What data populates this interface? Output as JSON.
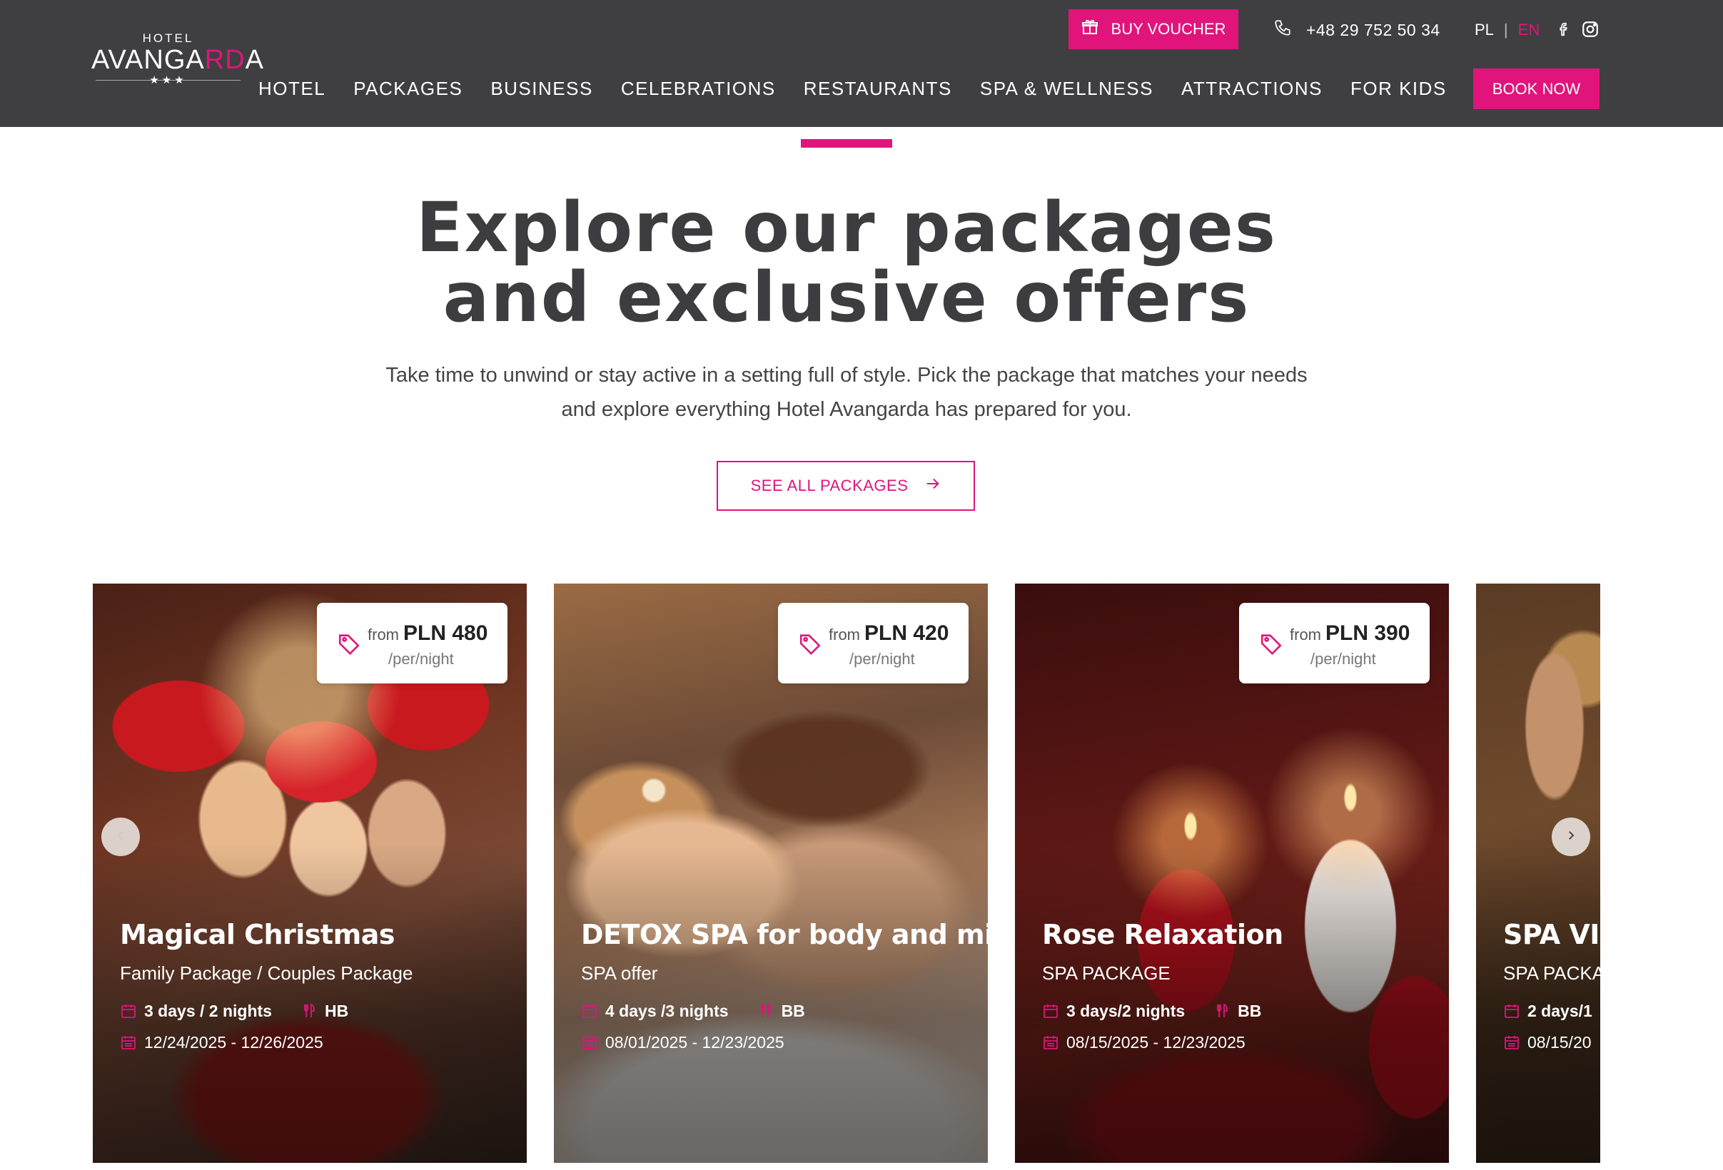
{
  "logo": {
    "small": "HOTEL",
    "big_pre": "AVANGA",
    "big_accent": "RD",
    "big_post": "A",
    "stars": "★★★"
  },
  "header": {
    "voucher_label": "BUY VOUCHER",
    "phone": "+48 29 752 50 34",
    "lang_pl": "PL",
    "lang_sep": "|",
    "lang_en": "EN",
    "book_label": "BOOK NOW"
  },
  "nav": [
    "HOTEL",
    "PACKAGES",
    "BUSINESS",
    "CELEBRATIONS",
    "RESTAURANTS",
    "SPA & WELLNESS",
    "ATTRACTIONS",
    "FOR KIDS"
  ],
  "intro": {
    "heading_line1": "Explore our packages",
    "heading_line2": "and exclusive offers",
    "lead_line1": "Take time to unwind or stay active in a setting full of style. Pick the package that matches your needs",
    "lead_line2": "and explore everything Hotel Avangarda has prepared for you.",
    "see_all": "SEE ALL PACKAGES"
  },
  "cards": [
    {
      "title": "Magical Christmas",
      "subtitle": "Family Package / Couples Package",
      "price_from": "from",
      "price": "PLN 480",
      "per": "/per/night",
      "duration": "3 days / 2 nights",
      "board": "HB",
      "dates": "12/24/2025 - 12/26/2025"
    },
    {
      "title": "DETOX SPA for body and mind",
      "subtitle": "SPA offer",
      "price_from": "from",
      "price": "PLN 420",
      "per": "/per/night",
      "duration": "4 days /3 nights",
      "board": "BB",
      "dates": "08/01/2025 - 12/23/2025"
    },
    {
      "title": "Rose Relaxation",
      "subtitle": "SPA PACKAGE",
      "price_from": "from",
      "price": "PLN 390",
      "per": "/per/night",
      "duration": "3 days/2 nights",
      "board": "BB",
      "dates": "08/15/2025 - 12/23/2025"
    },
    {
      "title": "SPA VISI",
      "subtitle": "SPA PACKA",
      "duration": "2 days/1",
      "dates": "08/15/20"
    }
  ],
  "colors": {
    "brand": "#e0147b",
    "header_bg": "#3f3f41",
    "text": "#3d3d3f"
  },
  "icons": [
    "gift-icon",
    "phone-icon",
    "facebook-icon",
    "instagram-icon",
    "arrow-right-icon",
    "price-tag-icon",
    "calendar-icon",
    "cutlery-icon",
    "chevron-left-icon",
    "chevron-right-icon"
  ]
}
